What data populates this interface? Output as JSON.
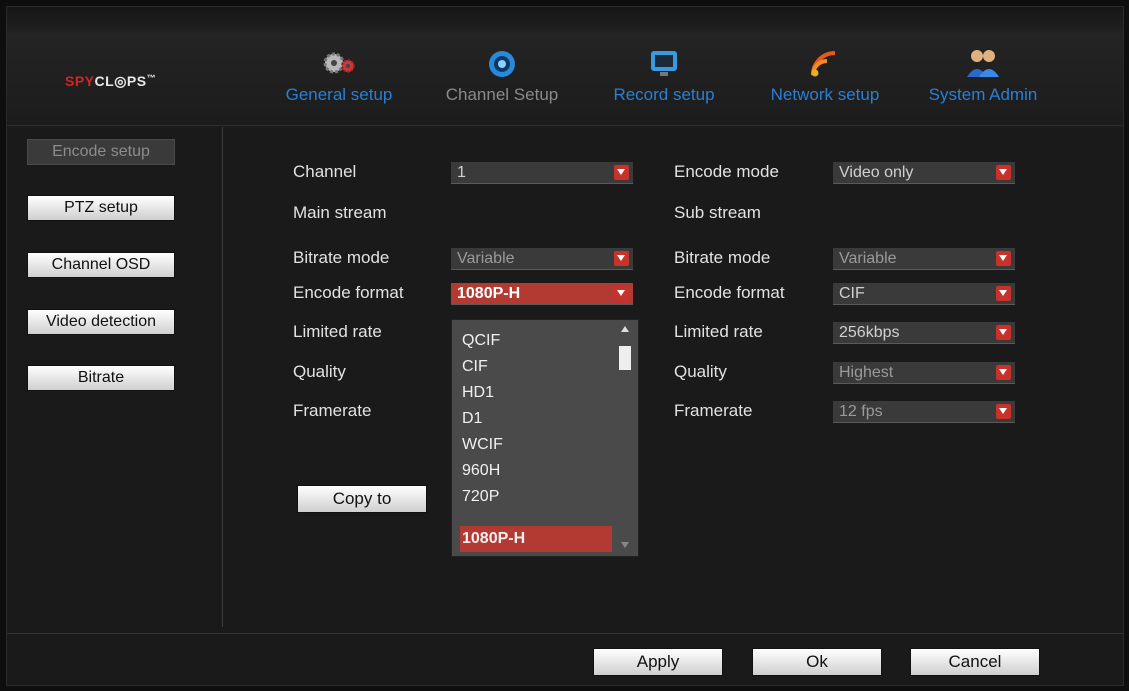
{
  "brand": {
    "logo_part1": "SPY",
    "logo_part2": "CL",
    "logo_part3": "PS",
    "logo_tm": "™"
  },
  "nav": [
    {
      "label": "General setup",
      "icon": "gears-icon"
    },
    {
      "label": "Channel Setup",
      "icon": "camera-icon"
    },
    {
      "label": "Record setup",
      "icon": "monitor-icon"
    },
    {
      "label": "Network setup",
      "icon": "wifi-icon"
    },
    {
      "label": "System Admin",
      "icon": "users-icon"
    }
  ],
  "sidebar": [
    {
      "label": "Encode setup",
      "active": true
    },
    {
      "label": "PTZ setup"
    },
    {
      "label": "Channel OSD"
    },
    {
      "label": "Video detection"
    },
    {
      "label": "Bitrate"
    }
  ],
  "form": {
    "channel_label": "Channel",
    "channel_value": "1",
    "encode_mode_label": "Encode mode",
    "encode_mode_value": "Video only",
    "main_stream_label": "Main stream",
    "sub_stream_label": "Sub stream",
    "main": {
      "bitrate_mode_label": "Bitrate mode",
      "bitrate_mode_value": "Variable",
      "encode_format_label": "Encode format",
      "encode_format_value": "1080P-H",
      "limited_rate_label": "Limited rate",
      "quality_label": "Quality",
      "framerate_label": "Framerate"
    },
    "sub": {
      "bitrate_mode_label": "Bitrate mode",
      "bitrate_mode_value": "Variable",
      "encode_format_label": "Encode format",
      "encode_format_value": "CIF",
      "limited_rate_label": "Limited rate",
      "limited_rate_value": "256kbps",
      "quality_label": "Quality",
      "quality_value": "Highest",
      "framerate_label": "Framerate",
      "framerate_value": "12 fps"
    },
    "copy_to_label": "Copy to"
  },
  "dropdown": {
    "options": [
      "QCIF",
      "CIF",
      "HD1",
      "D1",
      "WCIF",
      "960H",
      "720P",
      "1080P-H"
    ],
    "selected": "1080P-H"
  },
  "footer": {
    "apply_label": "Apply",
    "ok_label": "Ok",
    "cancel_label": "Cancel"
  },
  "colors": {
    "accent_red": "#c7332c",
    "nav_blue": "#2a7fd4"
  }
}
